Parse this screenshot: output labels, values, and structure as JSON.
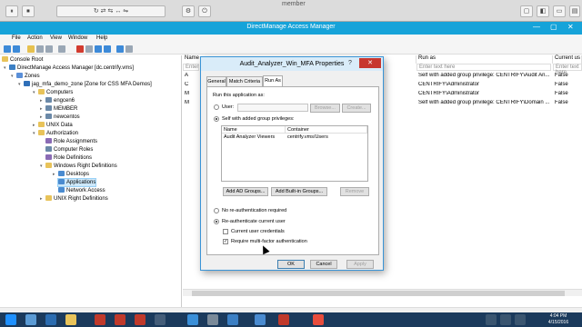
{
  "vm": {
    "title": "member",
    "buttons": [
      "⏸",
      "⏹",
      "↻",
      "⇄",
      "⇆",
      "↔",
      "⇋",
      "⚙",
      "⏻",
      "▢",
      "◧",
      "▭",
      "▤"
    ]
  },
  "window": {
    "title": "DirectManage Access Manager",
    "controls": [
      "—",
      "▢",
      "✕"
    ],
    "menu": [
      "File",
      "Action",
      "View",
      "Window",
      "Help"
    ]
  },
  "tree": [
    {
      "label": "Console Root",
      "icon": "folder-icon",
      "color": "#e8c35a"
    },
    {
      "label": "DirectManage Access Manager [dc.centrify.vms]",
      "icon": "app-icon",
      "color": "#3b7fc4"
    },
    {
      "label": "Zones",
      "icon": "zones-icon",
      "color": "#5a8fd8"
    },
    {
      "label": "jag_mfa_demo_zone [Zone for CSS MFA Demos]",
      "icon": "zone-icon",
      "color": "#2f6fb8"
    },
    {
      "label": "Computers",
      "icon": "folder-icon",
      "color": "#e8c35a"
    },
    {
      "label": "engcen6",
      "icon": "computer-icon",
      "color": "#6b89a8"
    },
    {
      "label": "MEMBER",
      "icon": "computer-icon",
      "color": "#6b89a8"
    },
    {
      "label": "newcentos",
      "icon": "computer-icon",
      "color": "#6b89a8"
    },
    {
      "label": "UNIX Data",
      "icon": "folder-icon",
      "color": "#e8c35a"
    },
    {
      "label": "Authorization",
      "icon": "folder-icon",
      "color": "#e8c35a"
    },
    {
      "label": "Role Assignments",
      "icon": "roles-icon",
      "color": "#8a6bb5"
    },
    {
      "label": "Computer Roles",
      "icon": "computer-roles-icon",
      "color": "#6b89a8"
    },
    {
      "label": "Role Definitions",
      "icon": "role-def-icon",
      "color": "#8a6bb5"
    },
    {
      "label": "Windows Right Definitions",
      "icon": "folder-icon",
      "color": "#e8c35a"
    },
    {
      "label": "Desktops",
      "icon": "desktop-icon",
      "color": "#4a8bd0"
    },
    {
      "label": "Applications",
      "icon": "application-icon",
      "color": "#4a8bd0"
    },
    {
      "label": "Network Access",
      "icon": "network-icon",
      "color": "#4a8bd0"
    },
    {
      "label": "UNIX Right Definitions",
      "icon": "folder-icon",
      "color": "#e8c35a"
    }
  ],
  "list": {
    "columns": [
      "Name",
      "Run as",
      "Current us"
    ],
    "filter_placeholder": "Enter text here",
    "name_prefix": "Enter",
    "rows": [
      {
        "name": "A",
        "run_as": "Self with added group privilege: CENTRIFY\\Audit An...",
        "current": "False"
      },
      {
        "name": "C",
        "run_as": "CENTRIFY\\Administrator",
        "current": "False"
      },
      {
        "name": "M",
        "run_as": "CENTRIFY\\Administrator",
        "current": "False"
      },
      {
        "name": "M",
        "run_as": "Self with added group privilege: CENTRIFY\\Domain ...",
        "current": "False"
      }
    ]
  },
  "dialog": {
    "title": "Audit_Analyzer_Win_MFA Properties",
    "help": "?",
    "close": "✕",
    "tabs": [
      "General",
      "Match Criteria",
      "Run As"
    ],
    "run_as_heading": "Run this application as:",
    "user_label": "User:",
    "browse": "Browse...",
    "create": "Create...",
    "self_label": "Self with added group privileges:",
    "grid_headers": [
      "Name",
      "Container"
    ],
    "grid_row": {
      "name": "Audit Analyzer Viewers",
      "container": "centrify.vms/Users"
    },
    "add_ad_groups": "Add AD Groups...",
    "add_builtin": "Add Built-in Groups...",
    "remove": "Remove",
    "no_reauth": "No re-authentication required",
    "reauth": "Re-authenticate current user",
    "current_creds": "Current user credentials",
    "require_mfa": "Require multi-factor authentication",
    "ok": "OK",
    "cancel": "Cancel",
    "apply": "Apply"
  },
  "taskbar": {
    "time": "4:04 PM",
    "date": "4/15/2016"
  }
}
